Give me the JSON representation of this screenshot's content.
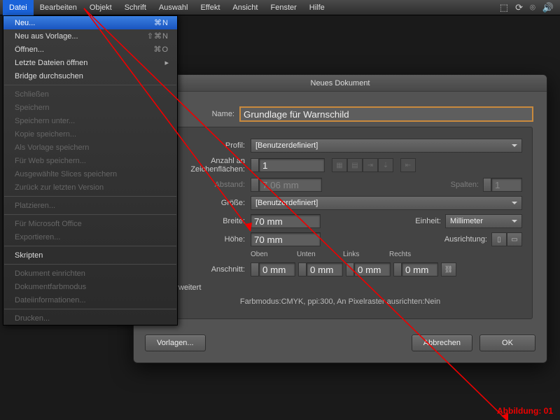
{
  "menubar": {
    "items": [
      "Datei",
      "Bearbeiten",
      "Objekt",
      "Schrift",
      "Auswahl",
      "Effekt",
      "Ansicht",
      "Fenster",
      "Hilfe"
    ],
    "status_icons": [
      "dropbox-icon",
      "sync-icon",
      "bluetooth-icon",
      "volume-icon"
    ]
  },
  "dropdown": {
    "groups": [
      [
        {
          "label": "Neu...",
          "shortcut": "⌘N",
          "highlight": true
        },
        {
          "label": "Neu aus Vorlage...",
          "shortcut": "⇧⌘N"
        },
        {
          "label": "Öffnen...",
          "shortcut": "⌘O"
        },
        {
          "label": "Letzte Dateien öffnen",
          "submenu": true
        },
        {
          "label": "Bridge durchsuchen",
          "shortcut": ""
        }
      ],
      [
        {
          "label": "Schließen",
          "disabled": true
        },
        {
          "label": "Speichern",
          "disabled": true
        },
        {
          "label": "Speichern unter...",
          "disabled": true
        },
        {
          "label": "Kopie speichern...",
          "disabled": true
        },
        {
          "label": "Als Vorlage speichern",
          "disabled": true
        },
        {
          "label": "Für Web speichern...",
          "disabled": true
        },
        {
          "label": "Ausgewählte Slices speichern",
          "disabled": true
        },
        {
          "label": "Zurück zur letzten Version",
          "disabled": true
        }
      ],
      [
        {
          "label": "Platzieren...",
          "disabled": true
        }
      ],
      [
        {
          "label": "Für Microsoft Office",
          "disabled": true
        },
        {
          "label": "Exportieren...",
          "disabled": true
        }
      ],
      [
        {
          "label": "Skripten",
          "submenu": true
        }
      ],
      [
        {
          "label": "Dokument einrichten",
          "disabled": true
        },
        {
          "label": "Dokumentfarbmodus",
          "disabled": true
        },
        {
          "label": "Dateiinformationen...",
          "disabled": true
        }
      ],
      [
        {
          "label": "Drucken...",
          "disabled": true
        }
      ]
    ]
  },
  "dialog": {
    "title": "Neues Dokument",
    "name_label": "Name:",
    "name_value": "Grundlage für Warnschild",
    "profile_label": "Profil:",
    "profile_value": "[Benutzerdefiniert]",
    "artboards_label": "Anzahl an Zeichenflächen:",
    "artboards_value": "1",
    "spacing_label": "Abstand:",
    "spacing_value": "7,06 mm",
    "columns_label": "Spalten:",
    "columns_value": "1",
    "size_label": "Größe:",
    "size_value": "[Benutzerdefiniert]",
    "width_label": "Breite:",
    "width_value": "70 mm",
    "unit_label": "Einheit:",
    "unit_value": "Millimeter",
    "height_label": "Höhe:",
    "height_value": "70 mm",
    "orient_label": "Ausrichtung:",
    "bleed_label": "Anschnitt:",
    "bleed_top": "Oben",
    "bleed_bottom": "Unten",
    "bleed_left": "Links",
    "bleed_right": "Rechts",
    "bleed_value": "0 mm",
    "advanced_label": "Erweitert",
    "summary": "Farbmodus:CMYK, ppi:300, An Pixelraster ausrichten:Nein",
    "templates_btn": "Vorlagen...",
    "cancel_btn": "Abbrechen",
    "ok_btn": "OK"
  },
  "annotation": "Abbildung: 01"
}
